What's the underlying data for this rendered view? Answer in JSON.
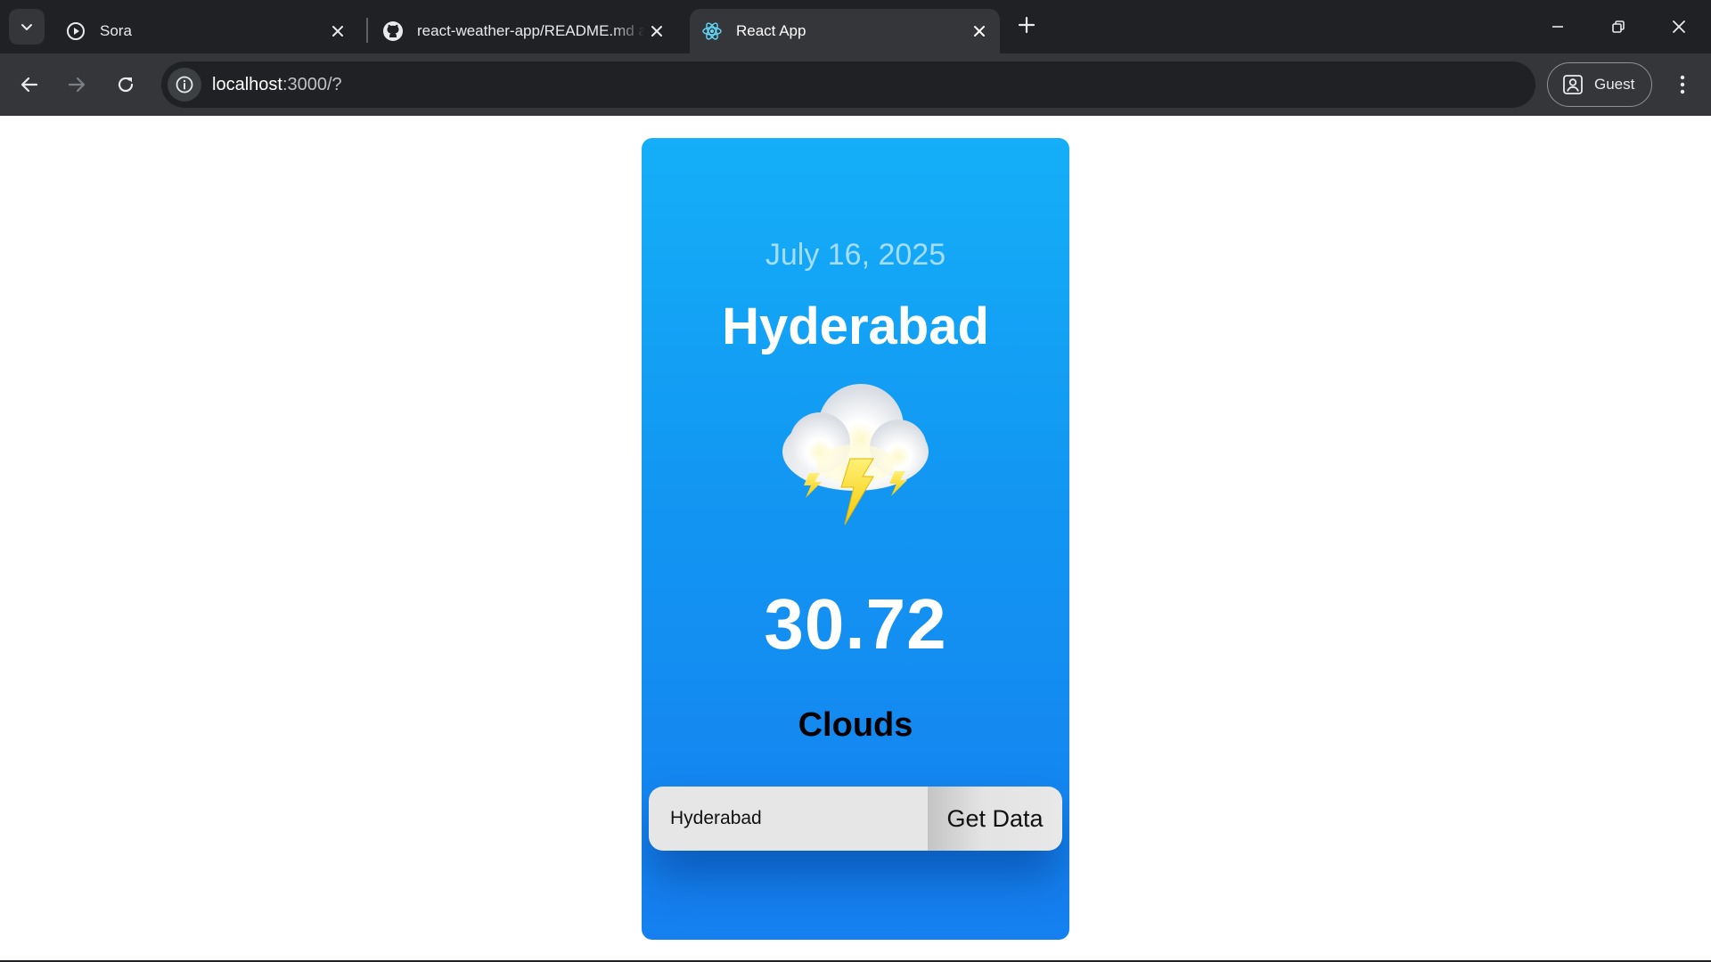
{
  "browser": {
    "tabs": [
      {
        "title": "Sora",
        "icon": "play-circle-icon",
        "active": false
      },
      {
        "title": "react-weather-app/README.md at",
        "icon": "github-icon",
        "active": false
      },
      {
        "title": "React App",
        "icon": "react-icon",
        "active": true
      }
    ],
    "address": {
      "host": "localhost",
      "path": ":3000/?"
    },
    "profile": {
      "label": "Guest"
    }
  },
  "weather": {
    "date": "July 16, 2025",
    "city": "Hyderabad",
    "temperature": "30.72",
    "condition": "Clouds",
    "icon": "thunder-cloud-icon"
  },
  "search": {
    "input_value": "Hyderabad",
    "button_label": "Get Data"
  },
  "colors": {
    "card_top": "#14aff8",
    "card_bottom": "#157ff0",
    "chrome_dark": "#202124",
    "chrome_toolbar": "#35363a"
  }
}
